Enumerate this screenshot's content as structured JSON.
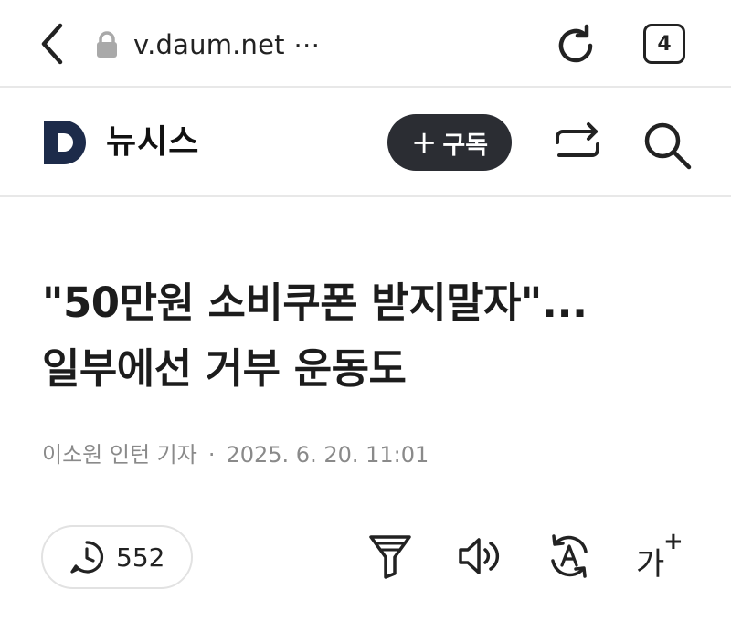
{
  "browser": {
    "url": "v.daum.net ⋯",
    "tab_count": "4"
  },
  "site": {
    "brand": "뉴시스",
    "subscribe_plus": "+",
    "subscribe_label": "구독"
  },
  "article": {
    "headline_line1": "\"50만원 소비쿠폰 받지말자\"...",
    "headline_line2": "일부에선 거부 운동도",
    "reporter": "이소원 인턴 기자",
    "separator": "·",
    "datetime": "2025. 6. 20. 11:01"
  },
  "toolbar": {
    "comment_count": "552",
    "font_label": "가",
    "font_plus": "+"
  },
  "icons": {
    "back": "chevron-left-icon",
    "lock": "lock-icon",
    "reload": "reload-icon",
    "share": "share-icon",
    "search": "search-icon",
    "comment": "comment-icon",
    "summary": "funnel-icon",
    "audio": "speaker-icon",
    "translate": "translate-icon"
  },
  "colors": {
    "brand_logo": "#1d2b4a",
    "subscribe_bg": "#2b2d33",
    "meta_text": "#8a8a8a"
  }
}
